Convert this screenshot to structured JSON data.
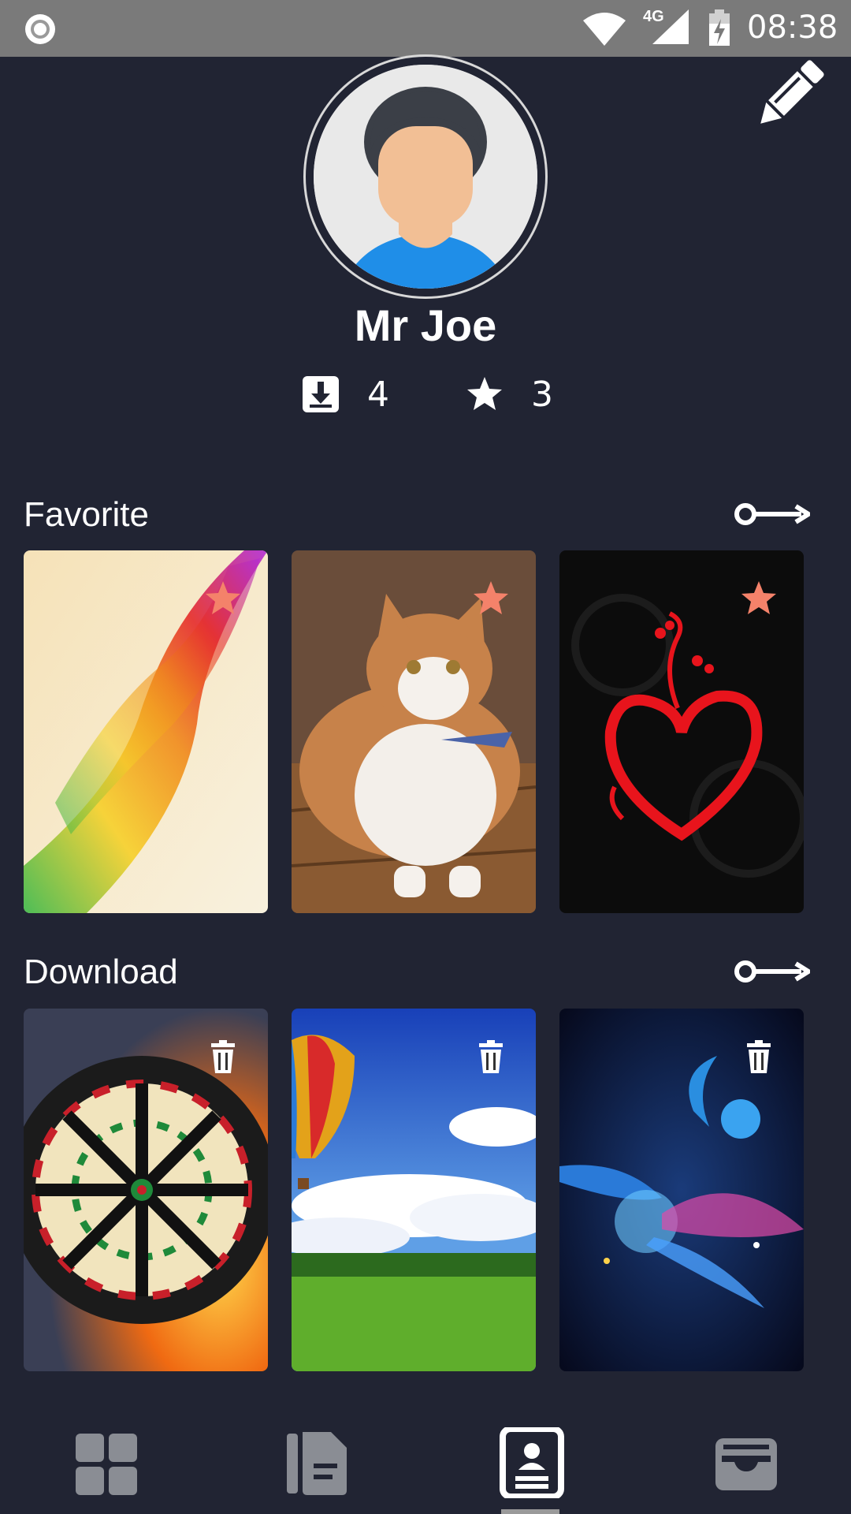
{
  "status_bar": {
    "network_label": "4G",
    "time": "08:38",
    "icons": [
      "record-icon",
      "wifi-icon",
      "signal-icon",
      "battery-charging-icon"
    ]
  },
  "profile": {
    "name": "Mr Joe",
    "downloads_count": "4",
    "favorites_count": "3",
    "edit_icon": "pencil-icon"
  },
  "sections": {
    "favorite": {
      "title": "Favorite",
      "items": [
        {
          "subject": "rainbow abstract wave",
          "badge": "star-icon"
        },
        {
          "subject": "orange and white cat",
          "badge": "star-icon"
        },
        {
          "subject": "red heart on black",
          "badge": "star-icon"
        }
      ]
    },
    "download": {
      "title": "Download",
      "items": [
        {
          "subject": "dartboard with fire and water",
          "badge": "trash-icon"
        },
        {
          "subject": "hot air balloon over meadow",
          "badge": "trash-icon"
        },
        {
          "subject": "blue abstract splash",
          "badge": "trash-icon"
        }
      ]
    }
  },
  "bottom_nav": {
    "items": [
      "grid-icon",
      "document-icon",
      "profile-card-icon",
      "inbox-icon"
    ],
    "active_index": 2
  },
  "colors": {
    "background": "#212433",
    "status_bar": "#7a7a7a",
    "star_badge": "#f4826a",
    "nav_inactive": "#8a8d94",
    "nav_active": "#ffffff"
  }
}
